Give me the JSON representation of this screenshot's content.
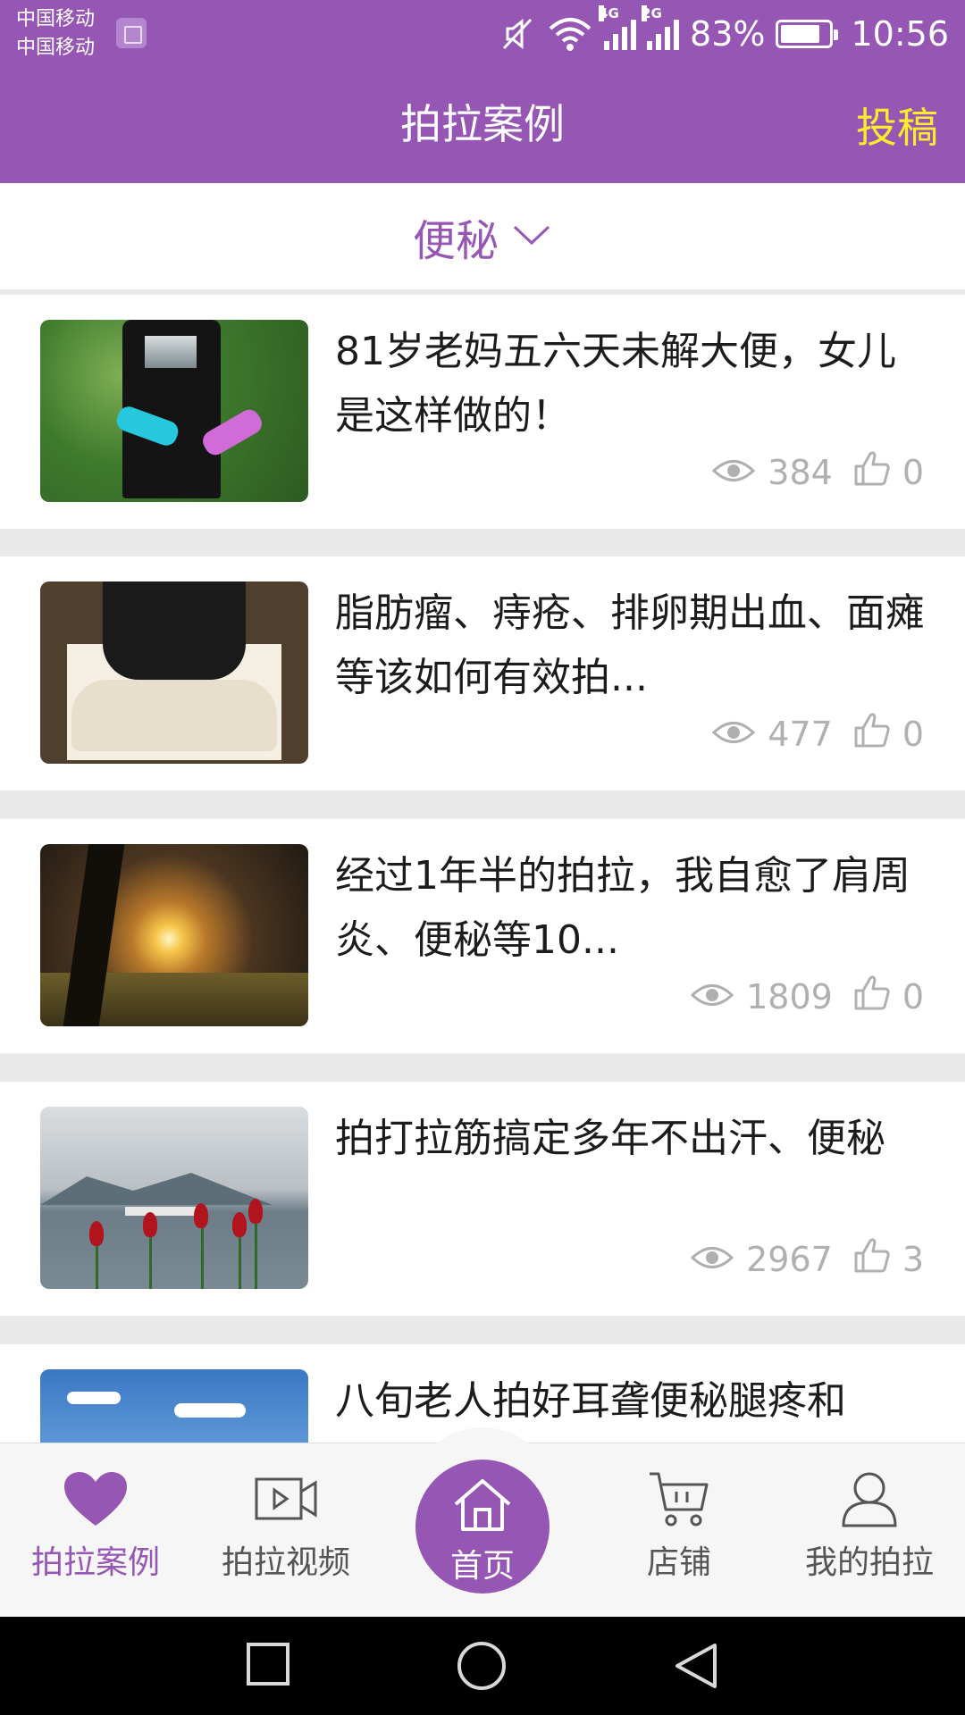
{
  "status_bar": {
    "carrier1": "中国移动",
    "carrier2": "中国移动",
    "net1": "4G",
    "net2": "2G",
    "battery_percent": "83%",
    "battery_level": 0.83,
    "time": "10:56"
  },
  "header": {
    "title": "拍拉案例",
    "submit_label": "投稿"
  },
  "filter": {
    "selected": "便秘"
  },
  "articles": [
    {
      "title": "81岁老妈五六天未解大便，女儿是这样做的！",
      "views": "384",
      "likes": "0"
    },
    {
      "title": "脂肪瘤、痔疮、排卵期出血、面瘫等该如何有效拍...",
      "views": "477",
      "likes": "0"
    },
    {
      "title": "经过1年半的拍拉，我自愈了肩周炎、便秘等10...",
      "views": "1809",
      "likes": "0"
    },
    {
      "title": "拍打拉筋搞定多年不出汗、便秘",
      "views": "2967",
      "likes": "3"
    },
    {
      "title": "八旬老人拍好耳聋便秘腿疼和",
      "views": "",
      "likes": ""
    }
  ],
  "bottom_nav": {
    "cases": "拍拉案例",
    "videos": "拍拉视频",
    "home": "首页",
    "shop": "店铺",
    "mine": "我的拍拉"
  },
  "colors": {
    "brand": "#9556b4",
    "submit": "#ffeb2b",
    "stats": "#b0b0b0"
  }
}
